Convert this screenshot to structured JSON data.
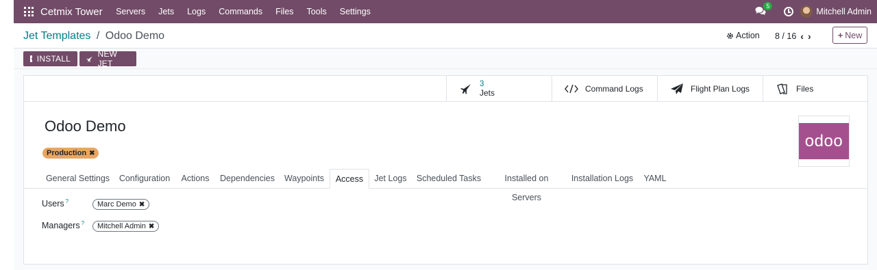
{
  "navbar": {
    "brand": "Cetmix Tower",
    "menu": [
      "Servers",
      "Jets",
      "Logs",
      "Commands",
      "Files",
      "Tools",
      "Settings"
    ],
    "chat_count": "5",
    "user": "Mitchell Admin"
  },
  "control": {
    "breadcrumb_parent": "Jet Templates",
    "breadcrumb_separator": "/",
    "breadcrumb_current": "Odoo Demo",
    "action_label": "Action",
    "pager": "8 / 16",
    "new_label": "New"
  },
  "statusbar": {
    "install_label": "INSTALL",
    "new_jet_label": "NEW JET"
  },
  "smart_buttons": {
    "jets_count": "3",
    "jets_label": "Jets",
    "command_logs": "Command Logs",
    "flight_plan_logs": "Flight Plan Logs",
    "files": "Files"
  },
  "record": {
    "title": "Odoo Demo",
    "tag": "Production",
    "logo_text": "odoo"
  },
  "tabs": [
    "General Settings",
    "Configuration",
    "Actions",
    "Dependencies",
    "Waypoints",
    "Access",
    "Jet Logs",
    "Scheduled Tasks",
    "Installed on Servers",
    "Installation Logs",
    "YAML"
  ],
  "active_tab": "Access",
  "fields": {
    "users_label": "Users",
    "users_value": "Marc Demo",
    "managers_label": "Managers",
    "managers_value": "Mitchell Admin",
    "help_marker": "?"
  },
  "colors": {
    "brand": "#714b67",
    "link": "#017e84",
    "tag_production": "#e8a662",
    "logo_bg": "#a5508e"
  }
}
